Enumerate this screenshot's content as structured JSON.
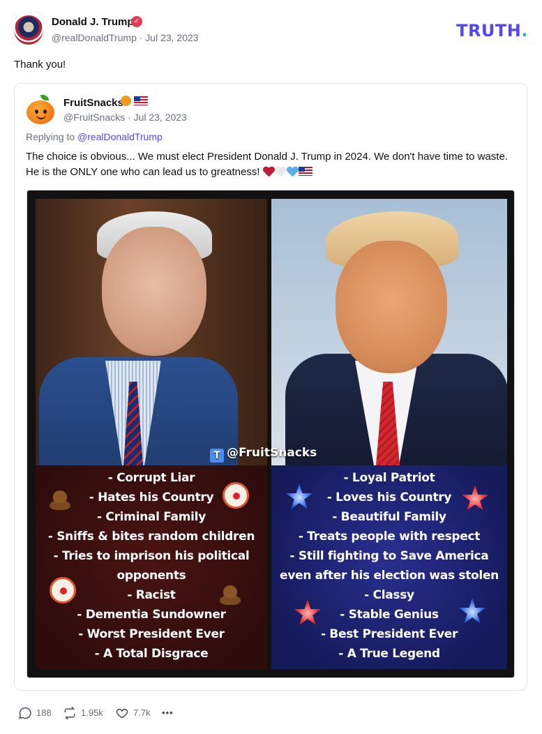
{
  "post": {
    "author_name": "Donald J. Trump",
    "handle_line": "@realDonaldTrump · Jul 23, 2023",
    "text": "Thank you!"
  },
  "brand": {
    "logo": "TRUTH",
    "logo_dot": "."
  },
  "quote": {
    "author_name": "FruitSnacks",
    "handle_line": "@FruitSnacks · Jul 23, 2023",
    "replying_prefix": "Replying to ",
    "replying_to": "@realDonaldTrump",
    "body": "The choice is obvious... We must elect President Donald J. Trump in 2024. We don't have time to waste. He is the ONLY one who can lead us to greatness!"
  },
  "meme": {
    "watermark": "@FruitSnacks",
    "left_list": [
      "- Corrupt Liar",
      "- Hates his Country",
      "- Criminal Family",
      "- Sniffs & bites random children",
      "- Tries to imprison his political",
      "opponents",
      "- Racist",
      "- Dementia Sundowner",
      "- Worst President Ever",
      "- A Total Disgrace"
    ],
    "right_list": [
      "- Loyal Patriot",
      "- Loves his Country",
      "- Beautiful Family",
      "- Treats people with respect",
      "- Still fighting to Save America",
      "even after his election was stolen",
      "- Classy",
      "- Stable Genius",
      "- Best President Ever",
      "- A True Legend"
    ]
  },
  "actions": {
    "replies": "188",
    "retruths": "1.95k",
    "likes": "7.7k",
    "more": "•••"
  },
  "colors": {
    "brand_purple": "#5448ee",
    "brand_teal": "#17c3a5",
    "verified": "#e23b57",
    "muted_text": "#6b6e7d"
  }
}
